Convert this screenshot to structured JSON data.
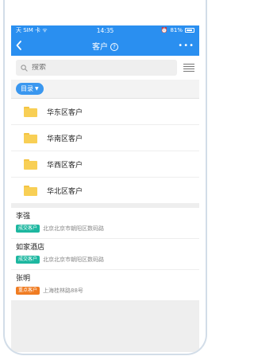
{
  "status_bar": {
    "carrier": "天 SIM 卡 ᯤ",
    "time": "14:35",
    "battery_text": "81%"
  },
  "nav": {
    "title": "客户",
    "help_icon_glyph": "?",
    "more_glyph": "•••"
  },
  "search": {
    "placeholder": "搜索"
  },
  "directory_tag": {
    "label": "目录"
  },
  "folders": [
    {
      "label": "华东区客户"
    },
    {
      "label": "华南区客户"
    },
    {
      "label": "华西区客户"
    },
    {
      "label": "华北区客户"
    }
  ],
  "customers": [
    {
      "name": "李强",
      "badge": "成交客户",
      "badge_color": "#1db7a0",
      "address": "北京北京市朝阳区数码路"
    },
    {
      "name": "如家酒店",
      "badge": "成交客户",
      "badge_color": "#1db7a0",
      "address": "北京北京市朝阳区数码路"
    },
    {
      "name": "张明",
      "badge": "重点客户",
      "badge_color": "#f07c22",
      "address": "上海桂林路88号"
    }
  ],
  "colors": {
    "primary": "#2a8ff0",
    "folder": "#f8cf55"
  }
}
